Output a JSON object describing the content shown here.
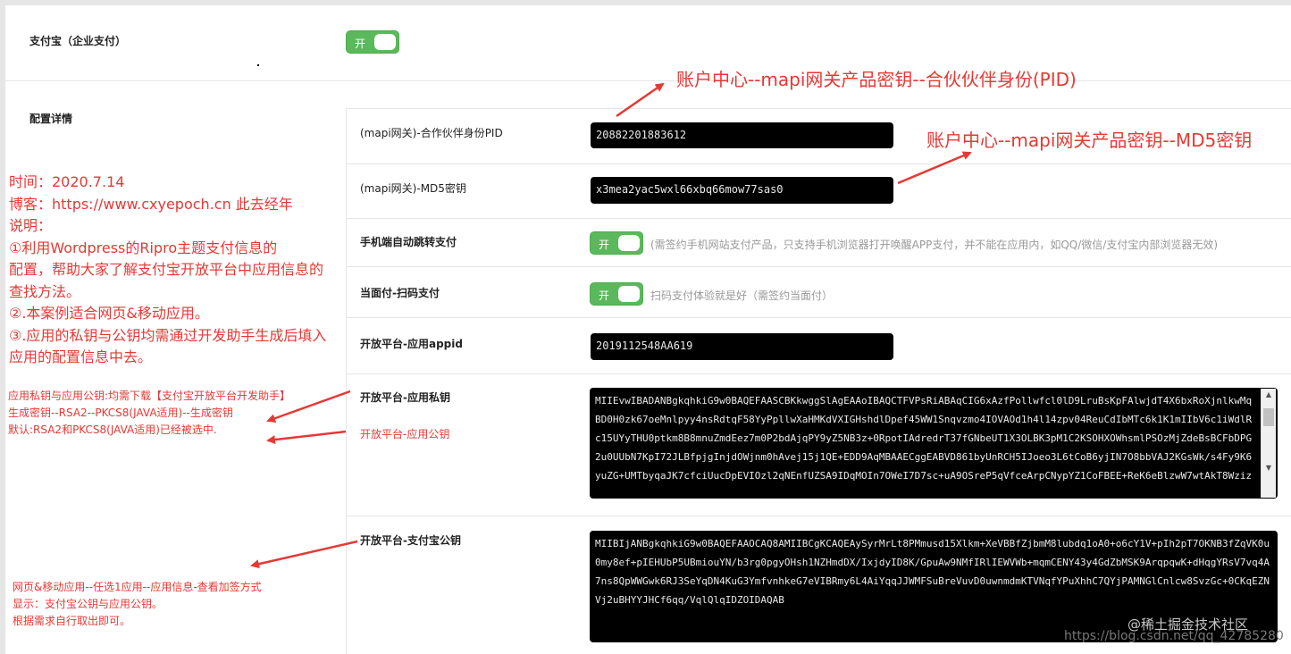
{
  "alipay_enterprise": {
    "label": "支付宝（企业支付）",
    "toggle_label": "开"
  },
  "config": {
    "section_label": "配置详情",
    "fields": {
      "pid": {
        "label": "(mapi网关)-合作伙伴身份PID",
        "value": "20882201883612"
      },
      "md5": {
        "label": "(mapi网关)-MD5密钥",
        "value": "x3mea2yac5wxl66xbq66mow77sas0"
      },
      "mobile_jump": {
        "label": "手机端自动跳转支付",
        "toggle_label": "开",
        "hint": "(需签约手机网站支付产品，只支持手机浏览器打开唤醒APP支付，并不能在应用内，如QQ/微信/支付宝内部浏览器无效)"
      },
      "f2f": {
        "label": "当面付-扫码支付",
        "toggle_label": "开",
        "hint": "扫码支付体验就是好（需签约当面付）"
      },
      "appid": {
        "label": "开放平台-应用appid",
        "value": "2019112548AA619"
      },
      "app_private_key": {
        "label": "开放平台-应用私钥",
        "value": "MIIEvwIBADANBgkqhkiG9w0BAQEFAASCBKkwggSlAgEAAoIBAQCTFVPsRiABAqCIG6xAzfPollwfcl0lD9LruBsKpFAlwjdT4X6bxRoXjnlkwMqBD0H0zk67oeMnlpyy4nsRdtqF58YyPpllwXaHMKdVXIGHshdlDpef45WW1Snqvzmo4IOVAOd1h4l14zpv04ReuCdIbMTc6k1K1mIIbV6c1iWdlRc15UYyTHU0ptkm8B8mnuZmdEez7m0P2bdAjqPY9yZ5NB3z+0RpotIAdredrT37fGNbeUT1X3OLBK3pM1C2KSOHXOWhsmlPSOzMjZdeBsBCFbDPG2u0UUbN7KpI72JLBfpjgInjdOWjnm0hAvej15j1QE+EDD9AqMBAAECggEABVD861byUnRCH5IJoeo3L6tCoB6yjIN7O8bbVAJ2KGsWk/s4Fy9K6yuZG+UMTbyqaJK7cfciUucDpEVIOzl2qNEnfUZSA9IDqMOIn7OWeI7D7sc+uA9OSreP5qVfceArpCNypYZ1CoFBEE+ReK6eBlzwW7wtAkT8Wziz"
      },
      "app_public_key": {
        "label": "开放平台-应用公钥"
      },
      "alipay_public_key": {
        "label": "开放平台-支付宝公钥",
        "value": "MIIBIjANBgkqhkiG9w0BAQEFAAOCAQ8AMIIBCgKCAQEAySyrMrLt8PMmusd15Xlkm+XeVBBfZjbmM8lubdq1oA0+o6cY1V+pIh2pT7OKNB3fZqVK0u0my8ef+pIEHUbP5UBmiouYN/b3rg0pgyOHsh1NZHmdDX/IxjdyID8K/GpuAw9NMfIRlIEWVWb+mqmCENY43y4GdZbMSK9ArqpqwK+dHqgYRsV7vq4A7ns8QpWWGwk6RJ3SeYqDN4KuG3YmfvnhkeG7eVIBRmy6L4AiYqqJJWMFSuBreVuvD0uwnmdmKTVNqfYPuXhhC7QYjPAMNGlCnlcw8SvzGc+0CKqEZNVj2uBHYYJHCf6qq/VqlQlqIDZOIDAQAB"
      }
    }
  },
  "annotations": {
    "pid_note": "账户中心--mapi网关产品密钥--合伙伙伴身份(PID)",
    "md5_note": "账户中心--mapi网关产品密钥--MD5密钥",
    "left_notes": [
      "时间：2020.7.14",
      "博客：https://www.cxyepoch.cn 此去经年",
      "说明：",
      "①利用Wordpress的Ripro主题支付信息的",
      "配置，帮助大家了解支付宝开放平台中应用信息的",
      "查找方法。",
      "②.本案例适合网页&移动应用。",
      "③.应用的私钥与公钥均需通过开发助手生成后填入",
      "应用的配置信息中去。"
    ],
    "key_notes": [
      "应用私钥与应用公钥:均需下载【支付宝开放平台开发助手】",
      "生成密钥--RSA2--PKCS8(JAVA适用)--生成密钥",
      "默认:RSA2和PKCS8(JAVA适用)已经被选中."
    ],
    "alipay_key_notes": [
      "网页&移动应用--任选1应用--应用信息-查看加签方式",
      "显示：支付宝公钥与应用公钥。",
      "根据需求自行取出即可。"
    ]
  },
  "watermark": {
    "text1": "@稀土掘金技术社区",
    "text2": "https://blog.csdn.net/qq_42785280"
  },
  "colors": {
    "toggle_green": "#5cb85c",
    "annotation_red": "#e53935"
  }
}
